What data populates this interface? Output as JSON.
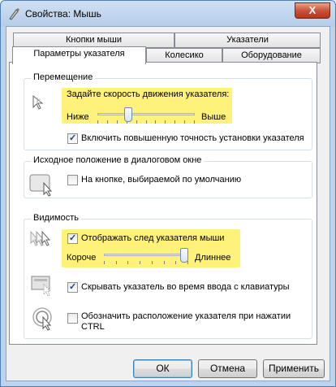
{
  "window": {
    "title": "Свойства: Мышь",
    "close_label": "X"
  },
  "tabs": {
    "row1": [
      "Кнопки мыши",
      "Указатели"
    ],
    "row2": [
      "Параметры указателя",
      "Колесико",
      "Оборудование"
    ]
  },
  "motion": {
    "title": "Перемещение",
    "speed_label": "Задайте скорость движения указателя:",
    "slow_label": "Ниже",
    "fast_label": "Выше",
    "speed_fraction": 0.3,
    "precision_label": "Включить повышенную точность установки указателя",
    "precision_checked": true
  },
  "snapto": {
    "title": "Исходное положение в диалоговом окне",
    "label": "На кнопке, выбираемой по умолчанию",
    "checked": false
  },
  "visibility": {
    "title": "Видимость",
    "trails_label": "Отображать след указателя мыши",
    "trails_checked": true,
    "short_label": "Короче",
    "long_label": "Длиннее",
    "trail_fraction": 1.0,
    "hide_label": "Скрывать указатель во время ввода с клавиатуры",
    "hide_checked": true,
    "ctrl_label_line1": "Обозначить расположение указателя при нажатии",
    "ctrl_label_line2": "CTRL",
    "ctrl_checked": false
  },
  "buttons": {
    "ok": "ОК",
    "cancel": "Отмена",
    "apply": "Применить"
  },
  "colors": {
    "highlight": "#fff27a",
    "title_bar": "#bcd3ec",
    "close": "#c9533a"
  }
}
